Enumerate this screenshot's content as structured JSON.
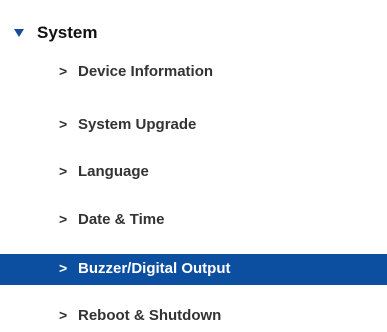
{
  "section": {
    "title": "System",
    "expanded": true,
    "arrow_icon": "triangle-down-icon",
    "arrow_color": "#1a4c9a"
  },
  "menu": {
    "prefix": ">",
    "items": [
      {
        "label": "Device Information",
        "selected": false
      },
      {
        "label": "System Upgrade",
        "selected": false
      },
      {
        "label": "Language",
        "selected": false
      },
      {
        "label": "Date & Time",
        "selected": false
      },
      {
        "label": "Buzzer/Digital Output",
        "selected": true
      },
      {
        "label": "Reboot & Shutdown",
        "selected": false
      }
    ]
  },
  "colors": {
    "selected_bg": "#0c4ea0",
    "selected_text": "#ffffff",
    "text": "#333333"
  }
}
